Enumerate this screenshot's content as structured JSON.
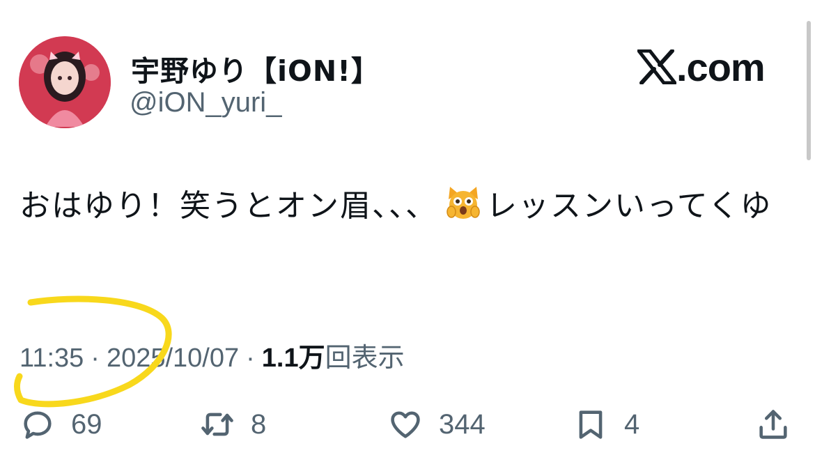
{
  "author": {
    "display_name": "宇野ゆり【iON!】",
    "handle": "@iON_yuri_",
    "avatar_icon": "profile-avatar"
  },
  "brand": {
    "text": ".com",
    "icon": "x-logo-icon"
  },
  "tweet": {
    "text_part1": "おはゆり！笑うとオン眉、、、",
    "emoji": "weary-cat-face",
    "text_part2": "レッスンいってくゆ"
  },
  "meta": {
    "time": "11:35",
    "date": "2025/10/07",
    "views_count": "1.1万",
    "views_label": "回表示",
    "separator": "·"
  },
  "actions": {
    "replies": "69",
    "reposts": "8",
    "likes": "344",
    "bookmarks": "4"
  },
  "colors": {
    "text": "#0f1419",
    "secondary": "#536471",
    "highlight": "#f8d81c"
  }
}
